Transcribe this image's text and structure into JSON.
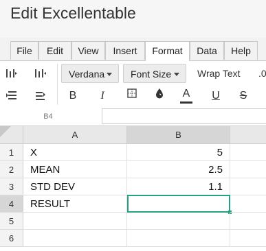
{
  "app": {
    "title": "Edit Excellentable"
  },
  "tabs": [
    {
      "label": "File"
    },
    {
      "label": "Edit"
    },
    {
      "label": "View"
    },
    {
      "label": "Insert"
    },
    {
      "label": "Format",
      "active": true
    },
    {
      "label": "Data"
    },
    {
      "label": "Help"
    }
  ],
  "toolbar": {
    "font_family": "Verdana",
    "font_size": "Font Size",
    "wrap_text": "Wrap Text",
    "decimal_label": ".0",
    "bold": "B",
    "italic": "I",
    "underline": "U",
    "strike": "S",
    "font_color_glyph": "A",
    "font_color_swatch": "#333333"
  },
  "formula_bar": {
    "cell_ref": "B4",
    "value": ""
  },
  "sheet": {
    "columns": [
      {
        "label": "A"
      },
      {
        "label": "B"
      }
    ],
    "rows": [
      {
        "num": "1",
        "a": "X",
        "b": "5"
      },
      {
        "num": "2",
        "a": "MEAN",
        "b": "2.5"
      },
      {
        "num": "3",
        "a": "STD DEV",
        "b": "1.1"
      },
      {
        "num": "4",
        "a": "RESULT",
        "b": ""
      },
      {
        "num": "5",
        "a": "",
        "b": ""
      },
      {
        "num": "6",
        "a": "",
        "b": ""
      }
    ],
    "active_cell": "B4",
    "selection_color": "#1fa382"
  }
}
